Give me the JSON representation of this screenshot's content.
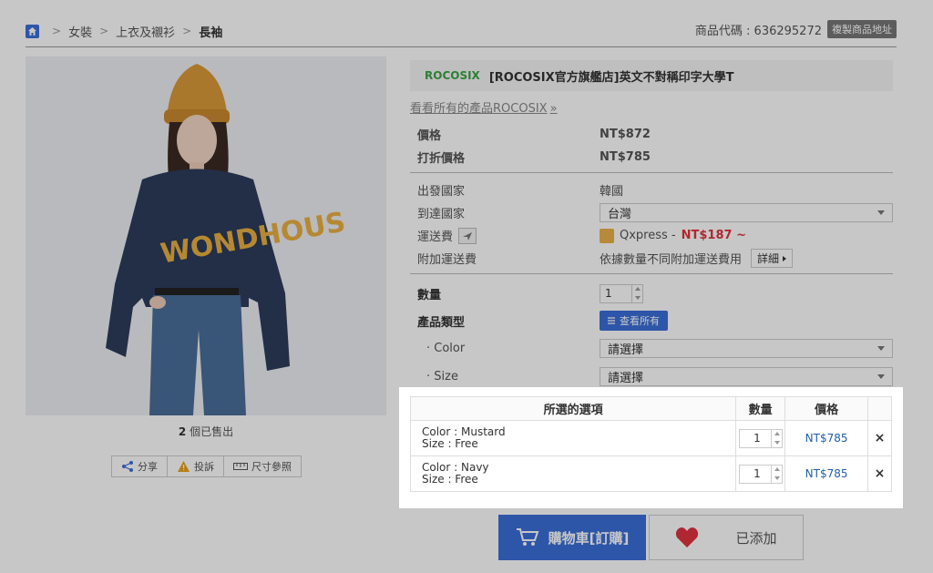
{
  "breadcrumb": {
    "items": [
      "女裝",
      "上衣及襯衫",
      "長袖"
    ],
    "separator": ">"
  },
  "product_code": {
    "label": "商品代碼 : 636295272",
    "copy_button": "複製商品地址"
  },
  "product": {
    "brand": "ROCOSIX",
    "title": "[ROCOSIX官方旗艦店]英文不對稱印字大學T",
    "all_products_link": "看看所有的產品ROCOSIX",
    "all_products_arrow": "»",
    "sold_count": "2",
    "sold_suffix": "個已售出"
  },
  "actions": {
    "share": "分享",
    "report": "投訴",
    "size": "尺寸參照"
  },
  "pricing": {
    "price_label": "價格",
    "price_value": "NT$872",
    "discount_label": "打折價格",
    "discount_value": "NT$785"
  },
  "shipping": {
    "origin_label": "出發國家",
    "origin_value": "韓國",
    "dest_label": "到達國家",
    "dest_value": "台灣",
    "fee_label": "運送費",
    "carrier": "Qxpress -",
    "fee_value": "NT$187 ~",
    "extra_label": "附加運送費",
    "extra_value": "依據數量不同附加運送費用",
    "detail_button": "詳細"
  },
  "quantity": {
    "label": "數量",
    "value": "1"
  },
  "options": {
    "type_label": "產品類型",
    "view_all": "查看所有",
    "color_label": "· Color",
    "color_placeholder": "請選擇",
    "size_label": "· Size",
    "size_placeholder": "請選擇"
  },
  "selected": {
    "headers": {
      "option": "所選的選項",
      "qty": "數量",
      "price": "價格"
    },
    "rows": [
      {
        "color": "Color : Mustard",
        "size": "Size : Free",
        "qty": "1",
        "price": "NT$785",
        "remove": "×"
      },
      {
        "color": "Color : Navy",
        "size": "Size : Free",
        "qty": "1",
        "price": "NT$785",
        "remove": "×"
      }
    ]
  },
  "buttons": {
    "cart": "購物車[訂購]",
    "favorite": "已添加"
  },
  "colors": {
    "accent": "#3b6fd8",
    "sale": "#e0323f",
    "brand": "#3aa343"
  }
}
